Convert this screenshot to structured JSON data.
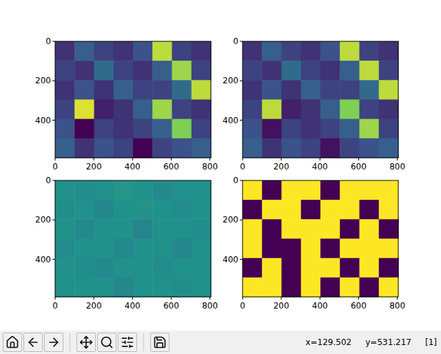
{
  "figure": {
    "axes": [
      {
        "x_ticks": [
          "0",
          "200",
          "400",
          "600",
          "800"
        ],
        "y_ticks": [
          "0",
          "200",
          "400"
        ],
        "x_max": 805,
        "y_max": 590,
        "values": [
          [
            0.15,
            0.3,
            0.2,
            0.15,
            0.25,
            0.9,
            0.2,
            0.15
          ],
          [
            0.2,
            0.15,
            0.35,
            0.2,
            0.15,
            0.3,
            0.85,
            0.2
          ],
          [
            0.15,
            0.25,
            0.15,
            0.3,
            0.2,
            0.2,
            0.35,
            0.9
          ],
          [
            0.2,
            0.95,
            0.1,
            0.15,
            0.3,
            0.85,
            0.2,
            0.15
          ],
          [
            0.25,
            0.0,
            0.2,
            0.15,
            0.2,
            0.3,
            0.8,
            0.2
          ],
          [
            0.3,
            0.15,
            0.25,
            0.2,
            0.0,
            0.2,
            0.25,
            0.3
          ]
        ]
      },
      {
        "x_ticks": [
          "0",
          "200",
          "400",
          "600",
          "800"
        ],
        "y_ticks": [
          "0",
          "200",
          "400"
        ],
        "x_max": 805,
        "y_max": 590,
        "values": [
          [
            0.15,
            0.3,
            0.2,
            0.15,
            0.25,
            0.9,
            0.2,
            0.15
          ],
          [
            0.2,
            0.15,
            0.35,
            0.2,
            0.15,
            0.3,
            0.9,
            0.2
          ],
          [
            0.15,
            0.25,
            0.15,
            0.3,
            0.2,
            0.2,
            0.35,
            0.9
          ],
          [
            0.2,
            0.9,
            0.1,
            0.15,
            0.3,
            0.8,
            0.2,
            0.15
          ],
          [
            0.25,
            0.05,
            0.2,
            0.15,
            0.2,
            0.3,
            0.85,
            0.2
          ],
          [
            0.3,
            0.15,
            0.25,
            0.2,
            0.05,
            0.2,
            0.25,
            0.3
          ]
        ]
      },
      {
        "x_ticks": [
          "0",
          "200",
          "400",
          "600",
          "800"
        ],
        "y_ticks": [
          "0",
          "200",
          "400"
        ],
        "x_max": 805,
        "y_max": 590,
        "values": [
          [
            0.5,
            0.48,
            0.5,
            0.52,
            0.5,
            0.47,
            0.5,
            0.5
          ],
          [
            0.49,
            0.5,
            0.46,
            0.5,
            0.51,
            0.5,
            0.48,
            0.5
          ],
          [
            0.5,
            0.47,
            0.5,
            0.5,
            0.45,
            0.5,
            0.5,
            0.49
          ],
          [
            0.48,
            0.5,
            0.5,
            0.47,
            0.5,
            0.5,
            0.46,
            0.5
          ],
          [
            0.5,
            0.49,
            0.47,
            0.5,
            0.5,
            0.48,
            0.5,
            0.5
          ],
          [
            0.5,
            0.5,
            0.5,
            0.46,
            0.5,
            0.5,
            0.49,
            0.5
          ]
        ]
      },
      {
        "x_ticks": [
          "0",
          "200",
          "400",
          "600",
          "800"
        ],
        "y_ticks": [
          "0",
          "200",
          "400"
        ],
        "x_max": 805,
        "y_max": 590,
        "values": [
          [
            1,
            0,
            1,
            1,
            0,
            1,
            1,
            1
          ],
          [
            0,
            1,
            1,
            0,
            1,
            1,
            0,
            1
          ],
          [
            1,
            0,
            1,
            1,
            1,
            0,
            1,
            0
          ],
          [
            1,
            0,
            0,
            1,
            0,
            1,
            1,
            1
          ],
          [
            0,
            1,
            0,
            1,
            1,
            0,
            1,
            0
          ],
          [
            1,
            1,
            0,
            1,
            0,
            1,
            0,
            1
          ]
        ]
      }
    ]
  },
  "status_bar": {
    "x": "x=129.502",
    "y": "y=531.217",
    "figure": "[1]"
  }
}
